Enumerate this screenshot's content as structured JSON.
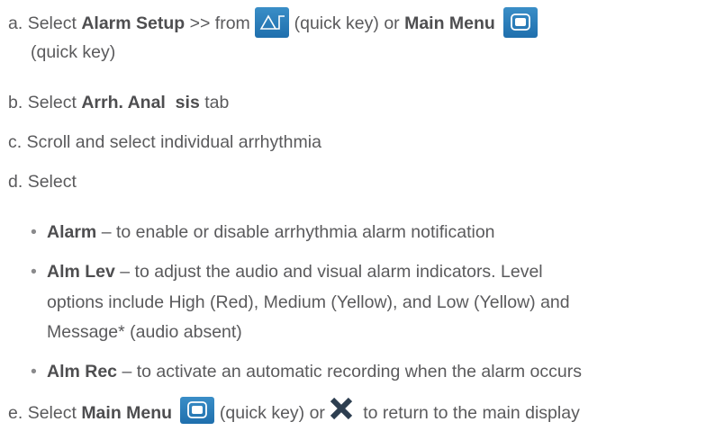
{
  "steps": {
    "a": {
      "marker": "a.",
      "t1": "Select ",
      "b1": "Alarm Setup",
      "t2": " >> from ",
      "t3": " (quick key) or ",
      "b2": "Main Menu",
      "line2": "(quick key)"
    },
    "b": {
      "marker": "b.",
      "t1": "Select ",
      "b1": "Arrh. Anal  sis",
      "t2": " tab"
    },
    "c": {
      "marker": "c.",
      "t1": "Scroll and select individual arrhythmia"
    },
    "d": {
      "marker": "d.",
      "t1": "Select",
      "bullets": [
        {
          "bold": "Alarm",
          "text": " – to enable or disable arrhythmia alarm notification"
        },
        {
          "bold": "Alm Lev",
          "text": " – to adjust the audio and visual alarm indicators. Level",
          "cont1": "options include High (Red), Medium (Yellow), and Low (Yellow) and",
          "cont2": "Message* (audio absent)"
        },
        {
          "bold": "Alm Rec",
          "text": " – to activate an automatic recording when the alarm occurs"
        }
      ]
    },
    "e": {
      "marker": "e.",
      "t1": "Select ",
      "b1": "Main Menu",
      "t2": " (quick key) or ",
      "t3": "  to return to the main display"
    }
  },
  "bullet_symbol": "•",
  "icons": {
    "alarm_key": "alarm-setup-quick-key-icon",
    "menu_key": "main-menu-quick-key-icon",
    "close": "close-x-icon"
  },
  "colors": {
    "text": "#5a5a5c",
    "key_blue": "#2a7fbd",
    "x_dark": "#2d3e50"
  }
}
